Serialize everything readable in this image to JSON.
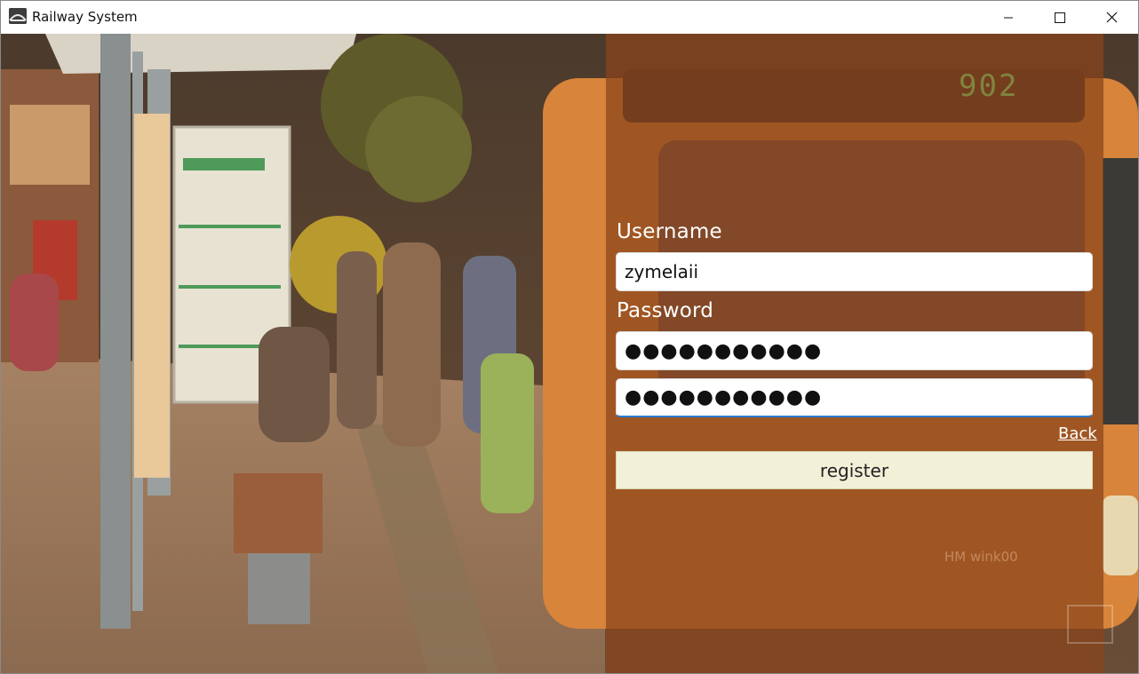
{
  "window": {
    "title": "Railway System"
  },
  "form": {
    "username_label": "Username",
    "username_value": "zymelaii",
    "password_label": "Password",
    "password_value": "●●●●●●●●●●●",
    "confirm_value": "●●●●●●●●●●●",
    "back_label": "Back",
    "register_label": "register"
  },
  "scene": {
    "bus_route_number": "902",
    "bus_plate": "HM wink00"
  },
  "colors": {
    "panel_overlay": "#8b441a",
    "register_button": "#f3f0d8",
    "focus_accent": "#2b7bd6"
  }
}
